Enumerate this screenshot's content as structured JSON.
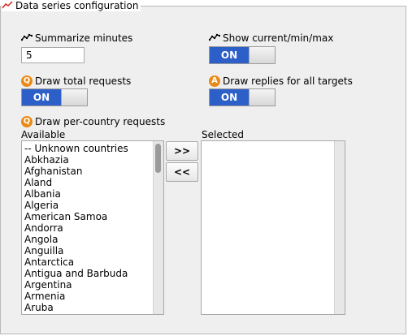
{
  "panel": {
    "title": "Data series configuration",
    "title_icon": "line-chart-icon"
  },
  "summarize": {
    "label": "Summarize minutes",
    "icon": "line-chart-icon",
    "value": "5"
  },
  "show_current": {
    "label": "Show current/min/max",
    "icon": "line-chart-icon",
    "toggle": "ON"
  },
  "total_requests": {
    "label": "Draw total requests",
    "badge": "Q",
    "toggle": "ON"
  },
  "replies_all": {
    "label": "Draw replies for all targets",
    "badge": "A",
    "toggle": "ON"
  },
  "per_country": {
    "label": "Draw per-country requests",
    "badge": "Q",
    "available_label": "Available",
    "selected_label": "Selected",
    "add_button": ">>",
    "remove_button": "<<",
    "available_items": [
      "-- Unknown countries",
      "Abkhazia",
      "Afghanistan",
      "Aland",
      "Albania",
      "Algeria",
      "American Samoa",
      "Andorra",
      "Angola",
      "Anguilla",
      "Antarctica",
      "Antigua and Barbuda",
      "Argentina",
      "Armenia",
      "Aruba"
    ],
    "selected_items": []
  },
  "colors": {
    "toggle_on": "#2c5fc8",
    "badge": "#e98a16",
    "chart_line": "#d9251d"
  }
}
